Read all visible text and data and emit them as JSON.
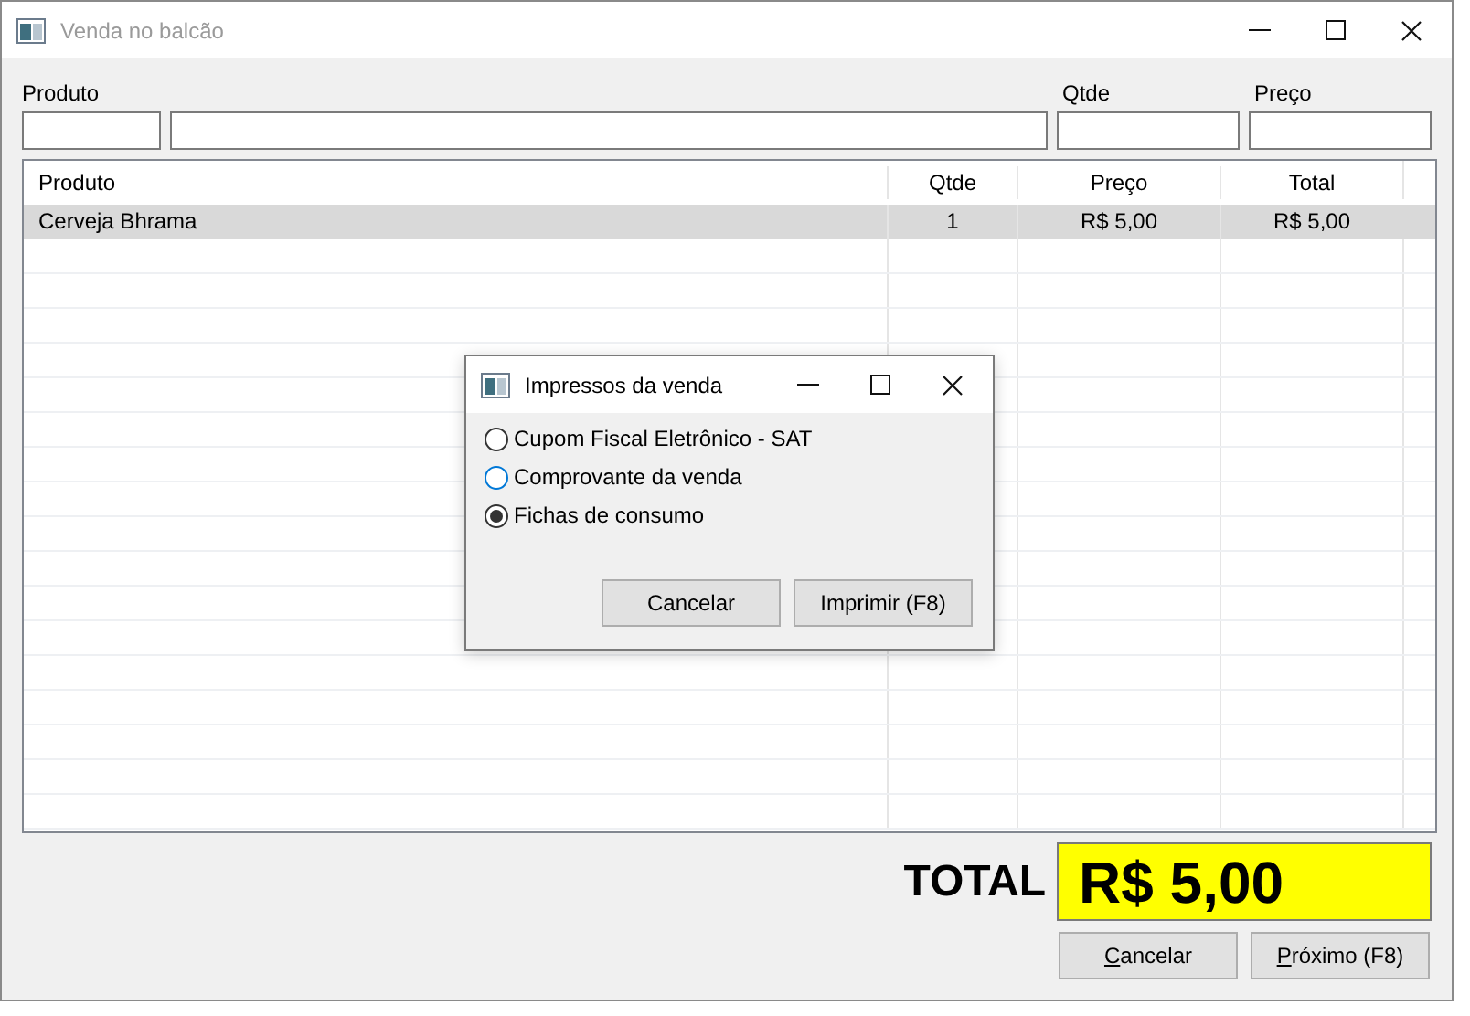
{
  "window": {
    "title": "Venda no balcão"
  },
  "form": {
    "labels": [
      "Produto",
      "Qtde",
      "Preço"
    ]
  },
  "table": {
    "columns": [
      "Produto",
      "Qtde",
      "Preço",
      "Total"
    ],
    "rows": [
      {
        "cells": [
          "Cerveja Bhrama",
          "1",
          "R$ 5,00",
          "R$ 5,00"
        ],
        "selected": true
      }
    ]
  },
  "dialog": {
    "title": "Impressos da venda",
    "options": [
      {
        "label": "Cupom Fiscal Eletrônico - SAT",
        "selected": false,
        "color": "#333333"
      },
      {
        "label": "Comprovante da venda",
        "selected": false,
        "color": "#0078d7"
      },
      {
        "label": "Fichas de consumo",
        "selected": true,
        "color": "#333333"
      }
    ],
    "buttons": [
      "Cancelar",
      "Imprimir (F8)"
    ]
  },
  "total": {
    "label": "TOTAL",
    "value": "R$ 5,00"
  },
  "buttons": [
    {
      "label": "Cancelar",
      "mnemonic": true
    },
    {
      "label": "Próximo (F8)",
      "mnemonic": true
    }
  ]
}
